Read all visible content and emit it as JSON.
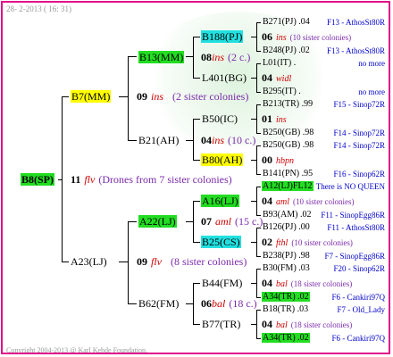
{
  "header_date": "28-  2-2013 ( 16: 31)",
  "footer": "Copyright 2004-2013 @ Karl Kehde Foundation.",
  "root": {
    "label": "B8(SP)",
    "num": "11",
    "gen": "flv",
    "note": "(Drones from 7 sister colonies)"
  },
  "b7": {
    "label": "B7(MM)",
    "num": "09",
    "gen": "ins",
    "note": "(2 sister colonies)"
  },
  "a23": {
    "label": "A23(LJ)",
    "num": "09",
    "gen": "flv",
    "note": "(8 sister colonies)"
  },
  "b13": {
    "label": "B13(MM)",
    "num": "08",
    "gen": "ins",
    "note": "(2 c.)"
  },
  "b21": {
    "label": "B21(AH)",
    "num": "04",
    "gen": "ins",
    "note": "(10 c.)"
  },
  "a22": {
    "label": "A22(LJ)",
    "num": "07",
    "gen": "aml",
    "note": "(15 c.)"
  },
  "b62": {
    "label": "B62(FM)",
    "num": "06",
    "gen": "bal",
    "note": "(18 c.)"
  },
  "g3": [
    {
      "label": "B188(PJ)",
      "bg": "c"
    },
    {
      "label": "L401(BG)",
      "bg": ""
    },
    {
      "label": "B50(IC)",
      "bg": ""
    },
    {
      "label": "B80(AH)",
      "bg": "y"
    },
    {
      "label": "A16(LJ)",
      "bg": "g"
    },
    {
      "label": "B25(CS)",
      "bg": "c"
    },
    {
      "label": "B44(FM)",
      "bg": ""
    },
    {
      "label": "B77(TR)",
      "bg": ""
    }
  ],
  "g4": [
    {
      "top": "B271(PJ) .04",
      "topr": "F13 - AthosSt80R",
      "num": "06",
      "gen": "ins",
      "note": "(10 sister colonies)",
      "bot": "B248(PJ) .02",
      "botr": "F13 - AthosSt80R",
      "topbg": "",
      "botbg": ""
    },
    {
      "top": "L01(IT) .",
      "topr": "no more",
      "num": "04",
      "gen": "widl",
      "note": "",
      "bot": "B295(IT) .",
      "botr": "no more",
      "topbg": "",
      "botbg": ""
    },
    {
      "top": "B213(TR) .99",
      "topr": "F15 - Sinop72R",
      "num": "01",
      "gen": "ins",
      "note": "",
      "bot": "B250(GB) .98",
      "botr": "F14 - Sinop72R",
      "topbg": "",
      "botbg": ""
    },
    {
      "top": "B250(GB) .98",
      "topr": "F14 - Sinop72R",
      "num": "00",
      "gen": "hbpn",
      "note": "",
      "bot": "B141(PN) .95",
      "botr": "F16 - Sinop62R",
      "topbg": "",
      "botbg": ""
    },
    {
      "top": "A12(LJ)FL12",
      "topr": "There is NO QUEEN",
      "num": "04",
      "gen": "aml",
      "note": "(10 sister colonies)",
      "bot": "B93(AM) .02",
      "botr": "F11 - SinopEgg86R",
      "topbg": "g",
      "botbg": ""
    },
    {
      "top": "B126(PJ) .00",
      "topr": "F11 - AthosSt80R",
      "num": "02",
      "gen": "fthl",
      "note": "(10 sister colonies)",
      "bot": "B238(PJ) .98",
      "botr": "F7 - SinopEgg86R",
      "topbg": "",
      "botbg": ""
    },
    {
      "top": "B30(FM) .03",
      "topr": "F20 - Sinop62R",
      "num": "04",
      "gen": "bal",
      "note": "(18 sister colonies)",
      "bot": "A34(TR) .02",
      "botr": "F6 - Cankiri97Q",
      "topbg": "",
      "botbg": "g"
    },
    {
      "top": "B18(TR) .03",
      "topr": "F7 - Old_Lady",
      "num": "04",
      "gen": "bal",
      "note": "(18 sister colonies)",
      "bot": "A34(TR) .02",
      "botr": "F6 - Cankiri97Q",
      "topbg": "",
      "botbg": "g"
    }
  ]
}
